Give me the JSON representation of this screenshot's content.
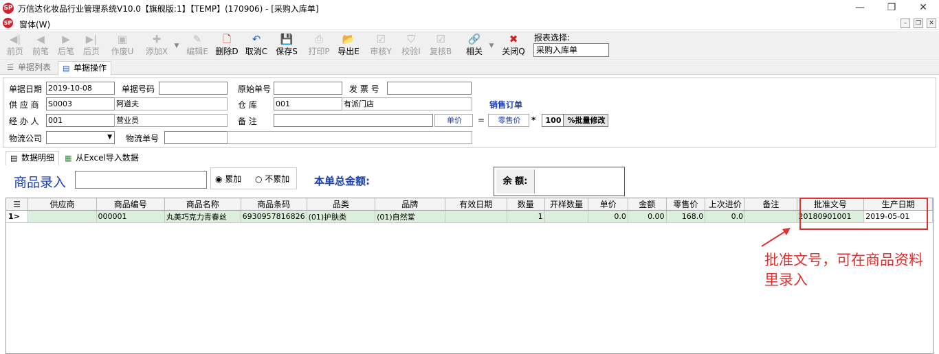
{
  "window": {
    "title": "万信达化妆品行业管理系统V10.0【旗舰版:1】【TEMP】(170906) - [采购入库单]",
    "logo": "SP"
  },
  "menu": {
    "label": "窗体(W)"
  },
  "toolbar": {
    "items": [
      {
        "label": "前页",
        "icon": "◀|",
        "enabled": false
      },
      {
        "label": "前笔",
        "icon": "◀",
        "enabled": false
      },
      {
        "label": "后笔",
        "icon": "▶",
        "enabled": false
      },
      {
        "label": "后页",
        "icon": "▶|",
        "enabled": false
      },
      {
        "label": "作废U",
        "icon": "▣",
        "enabled": false
      },
      {
        "label": "添加X",
        "icon": "✚",
        "enabled": false
      },
      {
        "label": "编辑E",
        "icon": "✎",
        "enabled": false
      },
      {
        "label": "删除D",
        "icon": "🗋",
        "enabled": true
      },
      {
        "label": "取消C",
        "icon": "↶",
        "enabled": true
      },
      {
        "label": "保存S",
        "icon": "💾",
        "enabled": true
      },
      {
        "label": "打印P",
        "icon": "⎙",
        "enabled": false
      },
      {
        "label": "导出E",
        "icon": "📂",
        "enabled": true
      },
      {
        "label": "审核Y",
        "icon": "☑",
        "enabled": false
      },
      {
        "label": "校验I",
        "icon": "⛉",
        "enabled": false
      },
      {
        "label": "复核B",
        "icon": "☑",
        "enabled": false
      },
      {
        "label": "相关",
        "icon": "🔗",
        "enabled": true
      },
      {
        "label": "关闭Q",
        "icon": "✖",
        "enabled": true
      }
    ],
    "report_label": "报表选择:",
    "report_value": "采购入库单"
  },
  "tabs": {
    "list": "单据列表",
    "op": "单据操作"
  },
  "form": {
    "date_label": "单据日期",
    "date": "2019-10-08",
    "no_label": "单据号码",
    "no": "",
    "orig_label": "原始单号",
    "orig": "",
    "invoice_label": "发 票 号",
    "invoice": "",
    "supplier_label": "供 应 商",
    "supplier_code": "S0003",
    "supplier_name": "阿道夫",
    "warehouse_label": "仓 库",
    "warehouse_code": "001",
    "warehouse_name": "有派门店",
    "sales_order": "销售订单",
    "handler_label": "经 办 人",
    "handler_code": "001",
    "handler_name": "营业员",
    "remark_label": "备 注",
    "remark": "",
    "price_label": "单价",
    "equals": "=",
    "retail_label": "零售价",
    "star": "*",
    "pct_value": "100",
    "batch_btn": "%批量修改",
    "logistics_label": "物流公司",
    "logistics": "",
    "tracking_label": "物流单号",
    "tracking": ""
  },
  "subtabs": {
    "detail": "数据明细",
    "excel": "从Excel导入数据"
  },
  "entry": {
    "label": "商品录入",
    "value": "",
    "radio1": "累加",
    "radio2": "不累加",
    "radio_selected": "累加",
    "total_label": "本单总金额:",
    "balance_label": "余 额:"
  },
  "grid": {
    "columns": [
      "供应商",
      "商品编号",
      "商品名称",
      "商品条码",
      "品类",
      "品牌",
      "有效日期",
      "数量",
      "开样数量",
      "单价",
      "金额",
      "零售价",
      "上次进价",
      "备注",
      "批准文号",
      "生产日期"
    ],
    "rows": [
      {
        "idx": "1>",
        "cells": [
          "",
          "000001",
          "丸美巧克力青春丝",
          "6930957816826",
          "(01)护肤类",
          "(01)自然堂",
          "",
          "1",
          "",
          "0.0",
          "0.00",
          "168.0",
          "0.0",
          "",
          "20180901001",
          "2019-05-01"
        ]
      }
    ]
  },
  "annotation": {
    "text": "批准文号，可在商品资料里录入",
    "color": "#e03030"
  }
}
